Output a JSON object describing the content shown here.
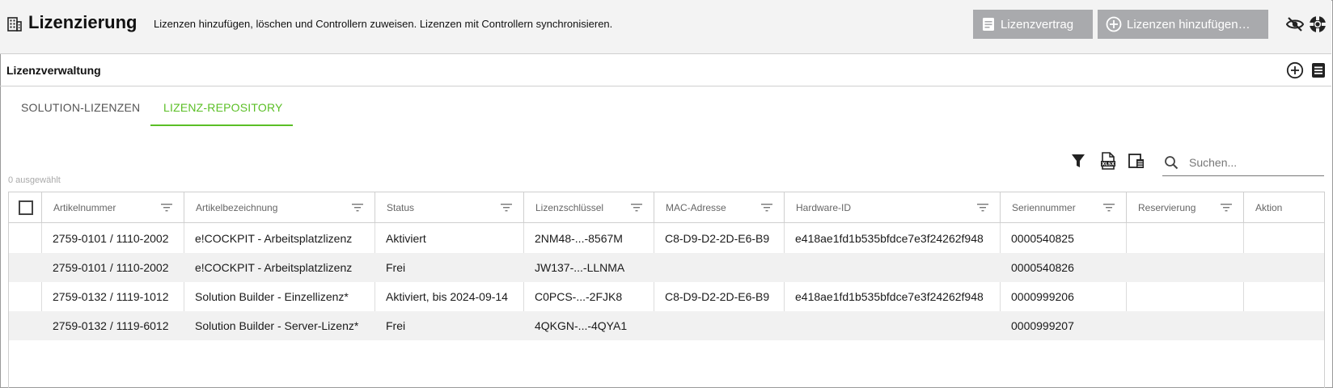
{
  "header": {
    "title": "Lizenzierung",
    "subtitle": "Lizenzen hinzufügen, löschen und Controllern zuweisen. Lizenzen mit Controllern synchronisieren.",
    "btn_contract": "Lizenzvertrag",
    "btn_add": "Lizenzen hinzufügen…"
  },
  "section": {
    "title": "Lizenzverwaltung"
  },
  "tabs": [
    {
      "label": "SOLUTION-LIZENZEN",
      "active": false
    },
    {
      "label": "LIZENZ-REPOSITORY",
      "active": true
    }
  ],
  "toolbar": {
    "search_placeholder": "Suchen...",
    "selected_count": "0 ausgewählt"
  },
  "table": {
    "columns": [
      "Artikelnummer",
      "Artikelbezeichnung",
      "Status",
      "Lizenzschlüssel",
      "MAC-Adresse",
      "Hardware-ID",
      "Seriennummer",
      "Reservierung",
      "Aktion"
    ],
    "rows": [
      [
        "2759-0101 / 1110-2002",
        "e!COCKPIT - Arbeitsplatzlizenz",
        "Aktiviert",
        "2NM48-...-8567M",
        "C8-D9-D2-2D-E6-B9",
        "e418ae1fd1b535bfdce7e3f24262f948",
        "0000540825",
        "",
        ""
      ],
      [
        "2759-0101 / 1110-2002",
        "e!COCKPIT - Arbeitsplatzlizenz",
        "Frei",
        "JW137-...-LLNMA",
        "",
        "",
        "0000540826",
        "",
        ""
      ],
      [
        "2759-0132 / 1119-1012",
        "Solution Builder - Einzellizenz*",
        "Aktiviert, bis 2024-09-14",
        "C0PCS-...-2FJK8",
        "C8-D9-D2-2D-E6-B9",
        "e418ae1fd1b535bfdce7e3f24262f948",
        "0000999206",
        "",
        ""
      ],
      [
        "2759-0132 / 1119-6012",
        "Solution Builder - Server-Lizenz*",
        "Frei",
        "4QKGN-...-4QYA1",
        "",
        "",
        "0000999207",
        "",
        ""
      ]
    ]
  },
  "colors": {
    "accent": "#5bbf26",
    "button_bg": "#a9aaad"
  }
}
